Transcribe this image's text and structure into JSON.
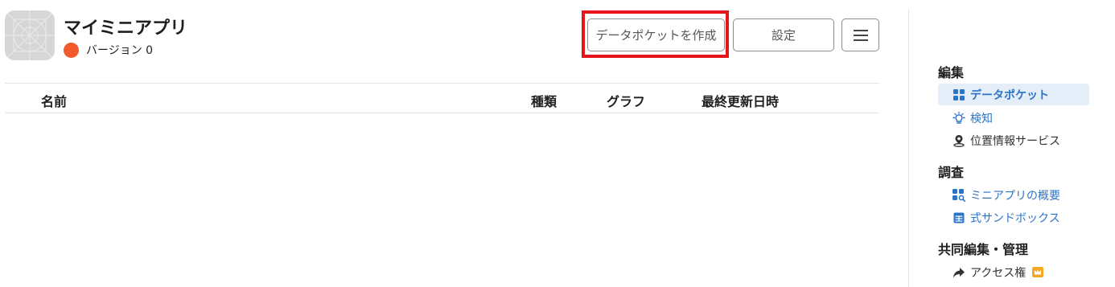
{
  "app": {
    "title": "マイミニアプリ",
    "version_label": "バージョン 0",
    "status_color": "#f15a2b"
  },
  "toolbar": {
    "create_label": "データポケットを作成",
    "settings_label": "設定",
    "menu_icon": "hamburger-icon",
    "highlight_color": "#e8141c"
  },
  "table": {
    "columns": [
      "名前",
      "種類",
      "グラフ",
      "最終更新日時"
    ],
    "rows": []
  },
  "sidebar": {
    "sections": [
      {
        "title": "編集",
        "items": [
          {
            "label": "データポケット",
            "icon": "grid-icon",
            "active": true,
            "color": "#2c74c6"
          },
          {
            "label": "検知",
            "icon": "lightbulb-icon",
            "active": false,
            "color": "#2c74c6"
          },
          {
            "label": "位置情報サービス",
            "icon": "location-pin-icon",
            "active": false,
            "color": "#333333"
          }
        ]
      },
      {
        "title": "調査",
        "items": [
          {
            "label": "ミニアプリの概要",
            "icon": "grid-search-icon",
            "active": false,
            "color": "#2c74c6"
          },
          {
            "label": "式サンドボックス",
            "icon": "table-icon",
            "active": false,
            "color": "#2c74c6"
          }
        ]
      },
      {
        "title": "共同編集・管理",
        "items": [
          {
            "label": "アクセス権",
            "icon": "share-arrow-icon",
            "active": false,
            "color": "#333333",
            "badge_color": "#f5a623"
          }
        ]
      }
    ]
  }
}
